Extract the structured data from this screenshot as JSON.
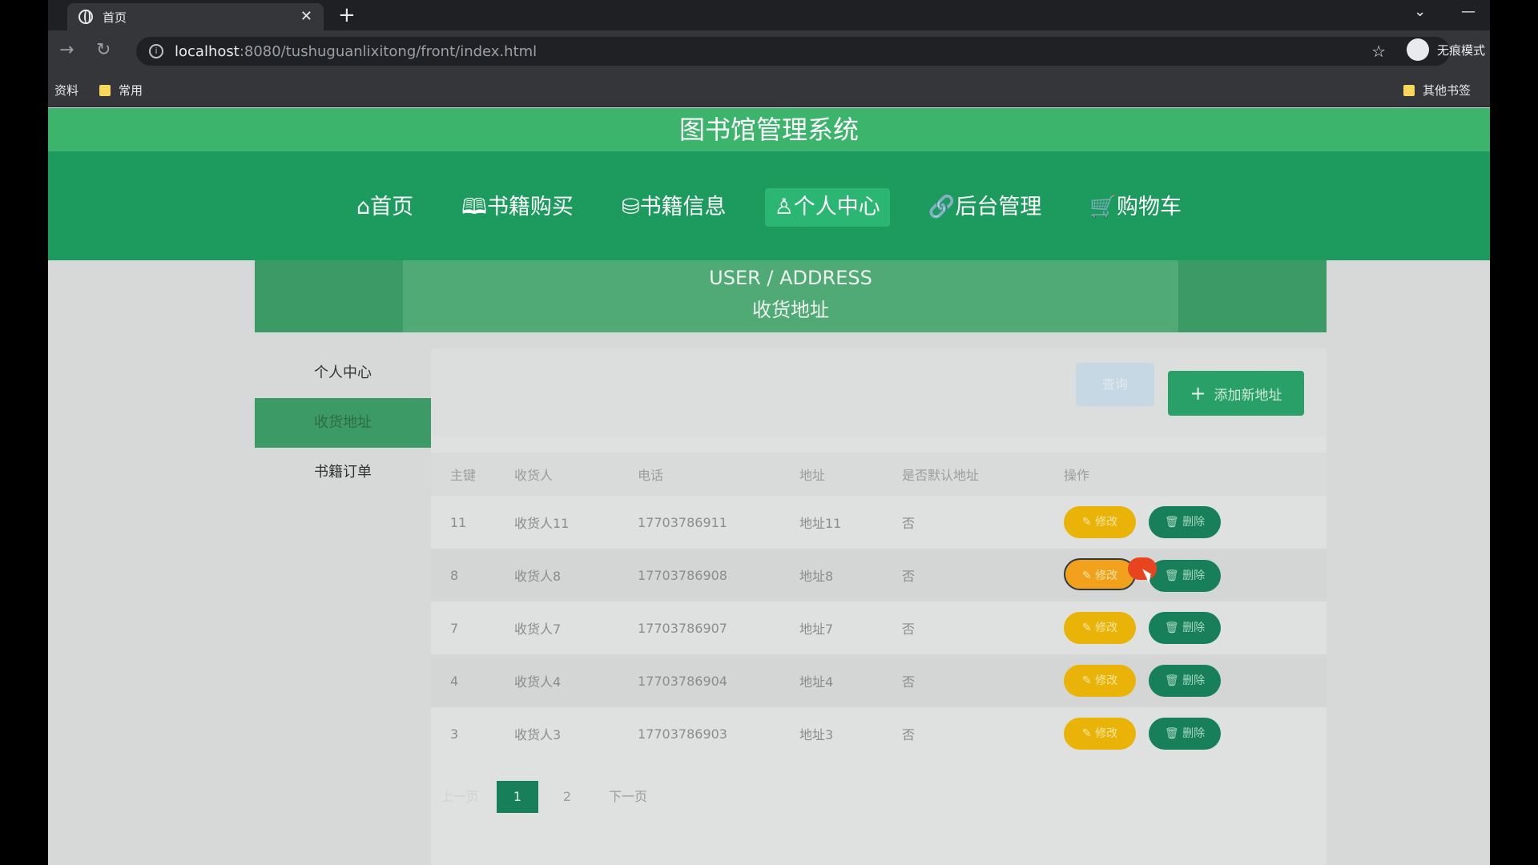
{
  "browser": {
    "tab_title": "首页",
    "url_host": "localhost",
    "url_path": ":8080/tushuguanlixitong/front/index.html",
    "incognito_label": "无痕模式",
    "bookmarks": [
      "资料",
      "常用"
    ],
    "other_bookmarks": "其他书签"
  },
  "site": {
    "title": "图书馆管理系统",
    "nav": [
      "首页",
      "书籍购买",
      "书籍信息",
      "个人中心",
      "后台管理",
      "购物车"
    ],
    "active_nav": "个人中心"
  },
  "banner": {
    "en": "USER / ADDRESS",
    "cn": "收货地址"
  },
  "sidebar": {
    "items": [
      "个人中心",
      "收货地址",
      "书籍订单"
    ],
    "active": "收货地址"
  },
  "toolbar": {
    "search_label": "查询",
    "add_label": "添加新地址"
  },
  "table": {
    "headers": [
      "主键",
      "收货人",
      "电话",
      "地址",
      "是否默认地址",
      "操作"
    ],
    "rows": [
      {
        "id": "11",
        "name": "收货人11",
        "phone": "17703786911",
        "address": "地址11",
        "default": "否"
      },
      {
        "id": "8",
        "name": "收货人8",
        "phone": "17703786908",
        "address": "地址8",
        "default": "否"
      },
      {
        "id": "7",
        "name": "收货人7",
        "phone": "17703786907",
        "address": "地址7",
        "default": "否"
      },
      {
        "id": "4",
        "name": "收货人4",
        "phone": "17703786904",
        "address": "地址4",
        "default": "否"
      },
      {
        "id": "3",
        "name": "收货人3",
        "phone": "17703786903",
        "address": "地址3",
        "default": "否"
      }
    ],
    "edit_label": "修改",
    "delete_label": "删除"
  },
  "pager": {
    "prev": "上一页",
    "pages": [
      "1",
      "2"
    ],
    "current": "1",
    "next": "下一页"
  }
}
